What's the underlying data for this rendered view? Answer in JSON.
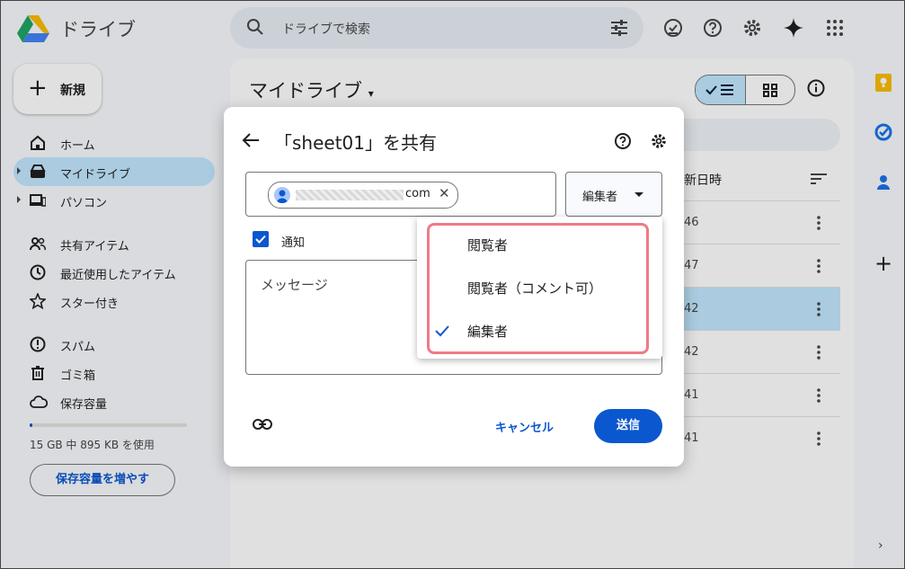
{
  "header": {
    "app_name": "ドライブ",
    "search_placeholder": "ドライブで検索"
  },
  "sidebar": {
    "new_label": "新規",
    "items": [
      {
        "label": "ホーム",
        "icon": "home-icon"
      },
      {
        "label": "マイドライブ",
        "icon": "drive-icon",
        "active": true
      },
      {
        "label": "パソコン",
        "icon": "computer-icon"
      },
      {
        "label": "共有アイテム",
        "icon": "people-icon"
      },
      {
        "label": "最近使用したアイテム",
        "icon": "clock-icon"
      },
      {
        "label": "スター付き",
        "icon": "star-icon"
      },
      {
        "label": "スパム",
        "icon": "spam-icon"
      },
      {
        "label": "ゴミ箱",
        "icon": "trash-icon"
      },
      {
        "label": "保存容量",
        "icon": "cloud-icon"
      }
    ],
    "storage_text": "15 GB 中 895 KB を使用",
    "storage_button": "保存容量を増やす"
  },
  "main": {
    "title": "マイドライブ",
    "column_header": "新日時",
    "rows": [
      "46",
      "47",
      "42",
      "42",
      "41",
      "41"
    ]
  },
  "dialog": {
    "title": "「sheet01」を共有",
    "chip_email_suffix": "com",
    "role_label": "編集者",
    "notify_label": "通知",
    "message_placeholder": "メッセージ",
    "cancel_label": "キャンセル",
    "send_label": "送信"
  },
  "role_menu": {
    "items": [
      {
        "label": "閲覧者",
        "selected": false
      },
      {
        "label": "閲覧者（コメント可）",
        "selected": false
      },
      {
        "label": "編集者",
        "selected": true
      }
    ]
  },
  "colors": {
    "accent": "#0b57d0",
    "selected_bg": "#c2e7ff",
    "highlight": "#f07a86"
  }
}
